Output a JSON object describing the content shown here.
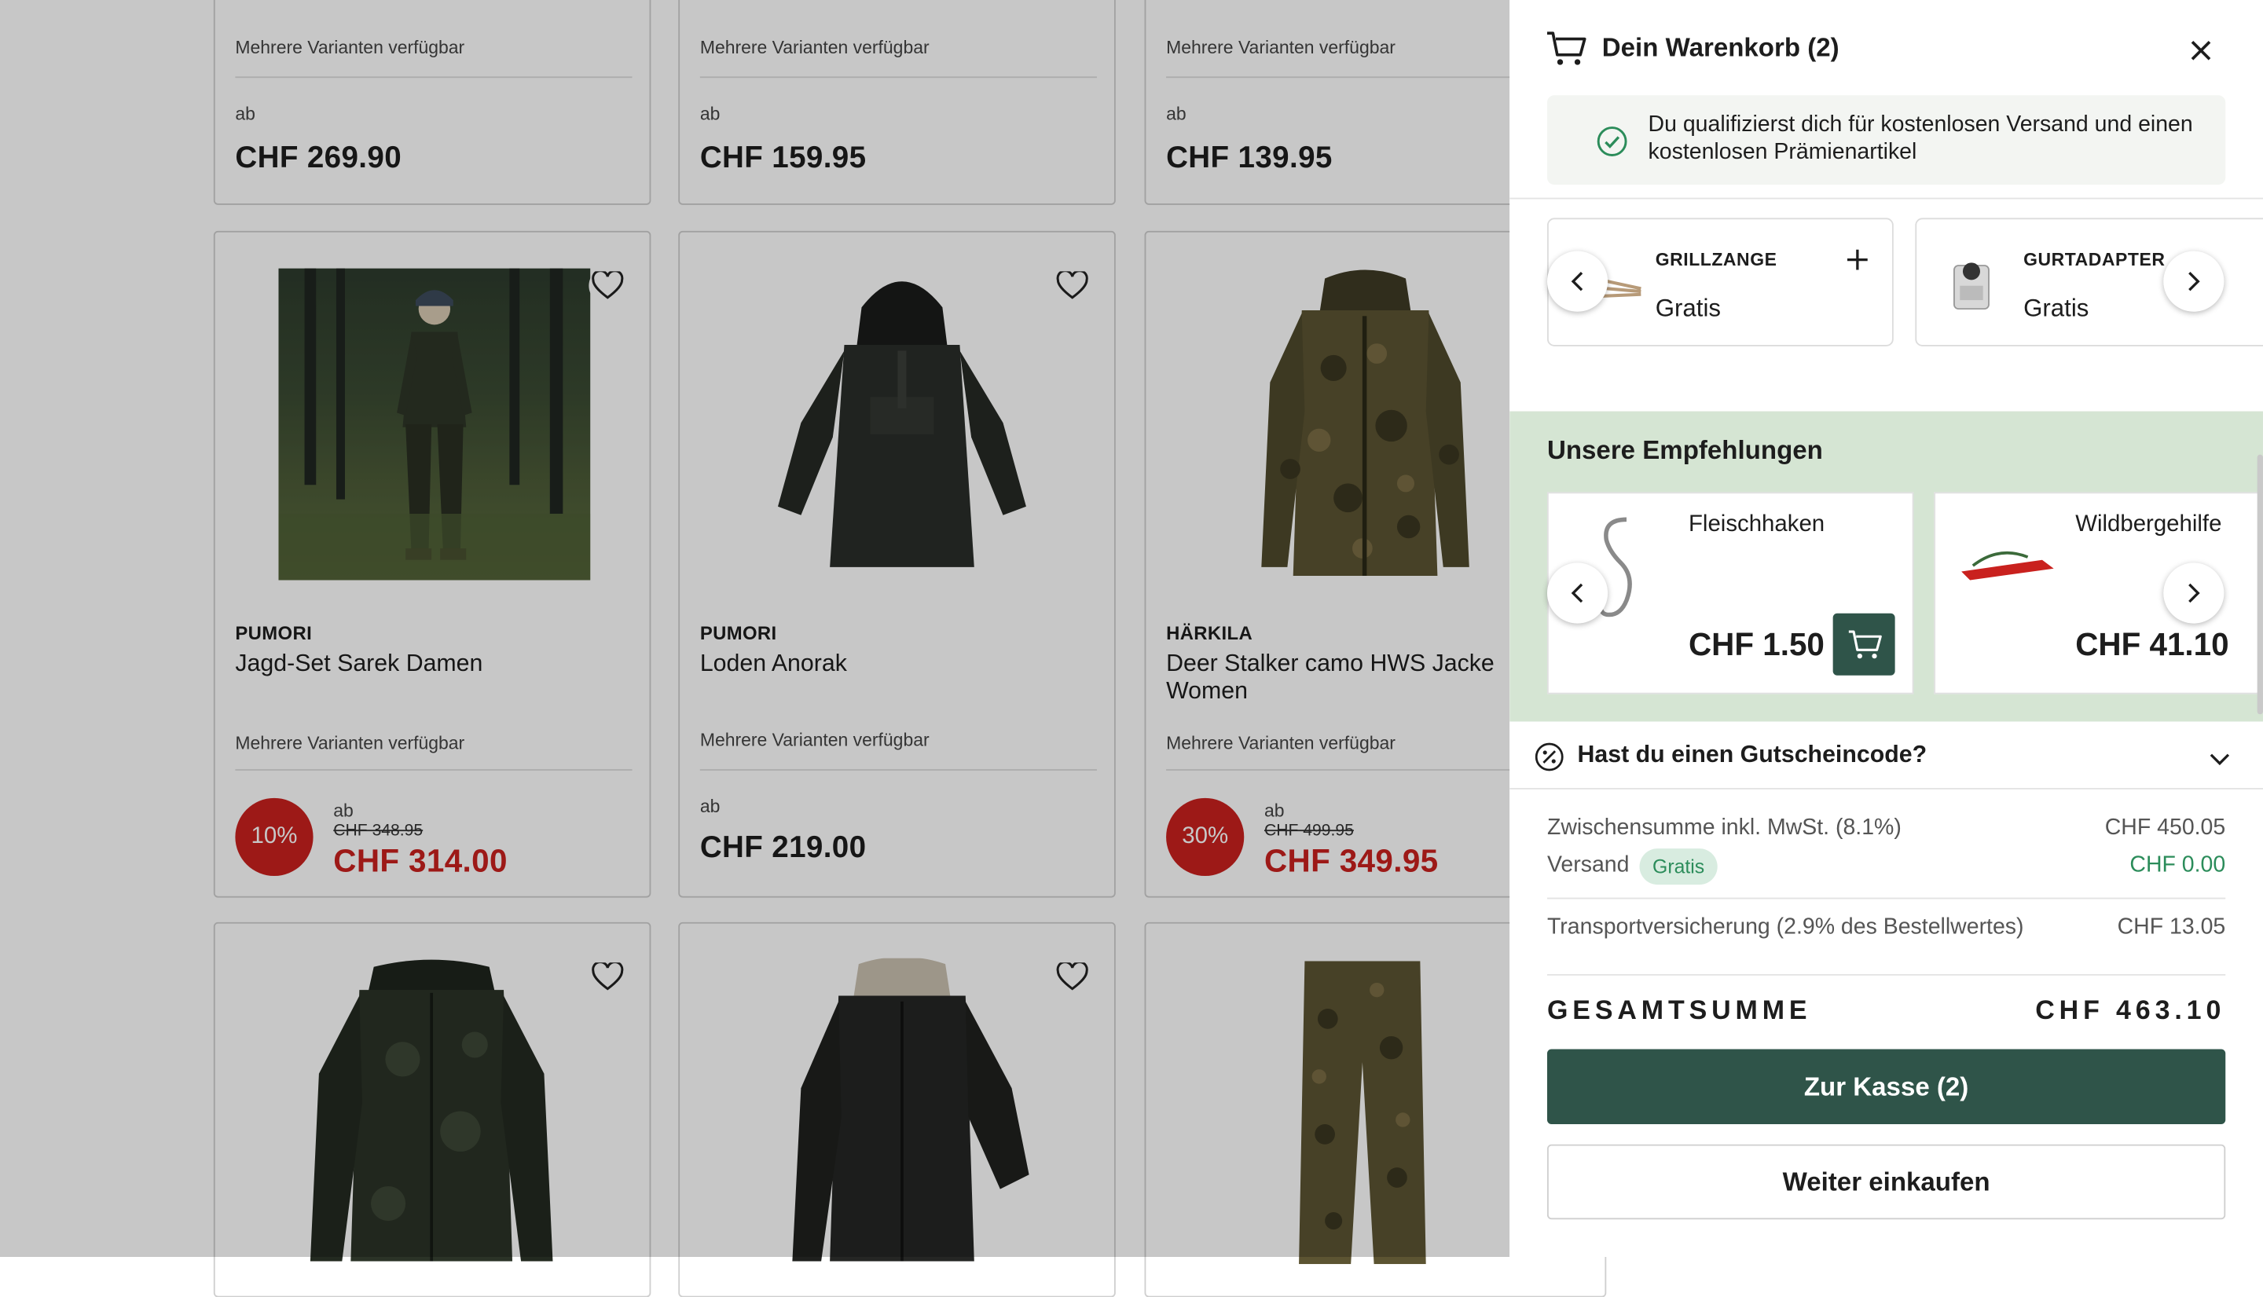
{
  "products": {
    "row1": [
      {
        "variants": "Mehrere Varianten verfügbar",
        "ab": "ab",
        "price": "CHF 269.90"
      },
      {
        "variants": "Mehrere Varianten verfügbar",
        "ab": "ab",
        "price": "CHF 159.95"
      },
      {
        "variants": "Mehrere Varianten verfügbar",
        "ab": "ab",
        "price": "CHF 139.95"
      }
    ],
    "row2": [
      {
        "brand": "PUMORI",
        "name": "Jagd-Set Sarek Damen",
        "variants": "Mehrere Varianten verfügbar",
        "discount": "10%",
        "ab": "ab",
        "old_price": "CHF 348.95",
        "price": "CHF 314.00"
      },
      {
        "brand": "PUMORI",
        "name": "Loden Anorak",
        "variants": "Mehrere Varianten verfügbar",
        "ab": "ab",
        "price": "CHF 219.00"
      },
      {
        "brand": "HÄRKILA",
        "name": "Deer Stalker camo HWS Jacke Women",
        "variants": "Mehrere Varianten verfügbar",
        "discount": "30%",
        "ab": "ab",
        "old_price": "CHF 499.95",
        "price": "CHF 349.95"
      }
    ]
  },
  "cart": {
    "title": "Dein Warenkorb (2)",
    "shipping_notice": "Du qualifizierst dich für kostenlosen Versand und einen kostenlosen Prämienartikel",
    "gifts": [
      {
        "name": "GRILLZANGE",
        "price": "Gratis"
      },
      {
        "name": "GURTADAPTER",
        "price": "Gratis"
      }
    ],
    "recommendations": {
      "title": "Unsere Empfehlungen",
      "items": [
        {
          "name": "Fleischhaken",
          "price": "CHF 1.50"
        },
        {
          "name": "Wildbergehilfe",
          "price": "CHF 41.10"
        }
      ]
    },
    "coupon_label": "Hast du einen Gutscheincode?",
    "subtotal_label": "Zwischensumme inkl. MwSt. (8.1%)",
    "subtotal_value": "CHF 450.05",
    "shipping_label": "Versand",
    "shipping_badge": "Gratis",
    "shipping_value": "CHF 0.00",
    "insurance_label": "Transportversicherung (2.9% des Bestellwertes)",
    "insurance_value": "CHF 13.05",
    "total_label": "GESAMTSUMME",
    "total_value": "CHF 463.10",
    "checkout_button": "Zur Kasse (2)",
    "continue_button": "Weiter einkaufen"
  },
  "colors": {
    "brand_green": "#2f5449",
    "sale_red": "#c9211e",
    "reco_bg": "#d5e5d3",
    "free_green": "#2b8c5a"
  }
}
